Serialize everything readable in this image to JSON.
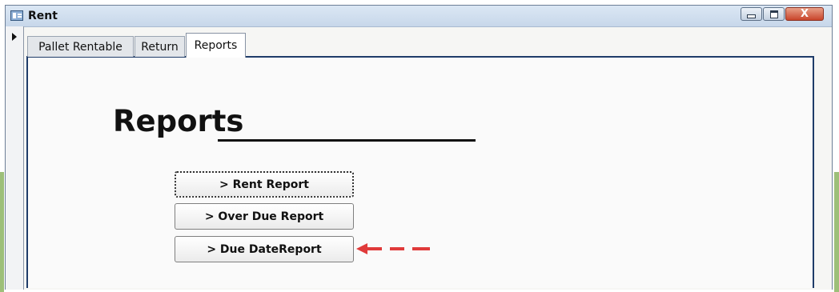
{
  "window": {
    "title": "Rent",
    "controls": {
      "minimize": "–",
      "maximize": "□",
      "close": "X"
    }
  },
  "tabs": [
    {
      "label": "Pallet Rentable",
      "selected": false
    },
    {
      "label": "Return",
      "selected": false
    },
    {
      "label": "Reports",
      "selected": true
    }
  ],
  "page": {
    "heading": "Reports",
    "buttons": [
      {
        "label": "> Rent Report",
        "focused": true
      },
      {
        "label": "> Over Due Report",
        "focused": false
      },
      {
        "label": "> Due DateReport",
        "focused": false
      }
    ]
  },
  "annotation": {
    "color": "#e03a3a",
    "icon": "dashed-left-arrow"
  }
}
